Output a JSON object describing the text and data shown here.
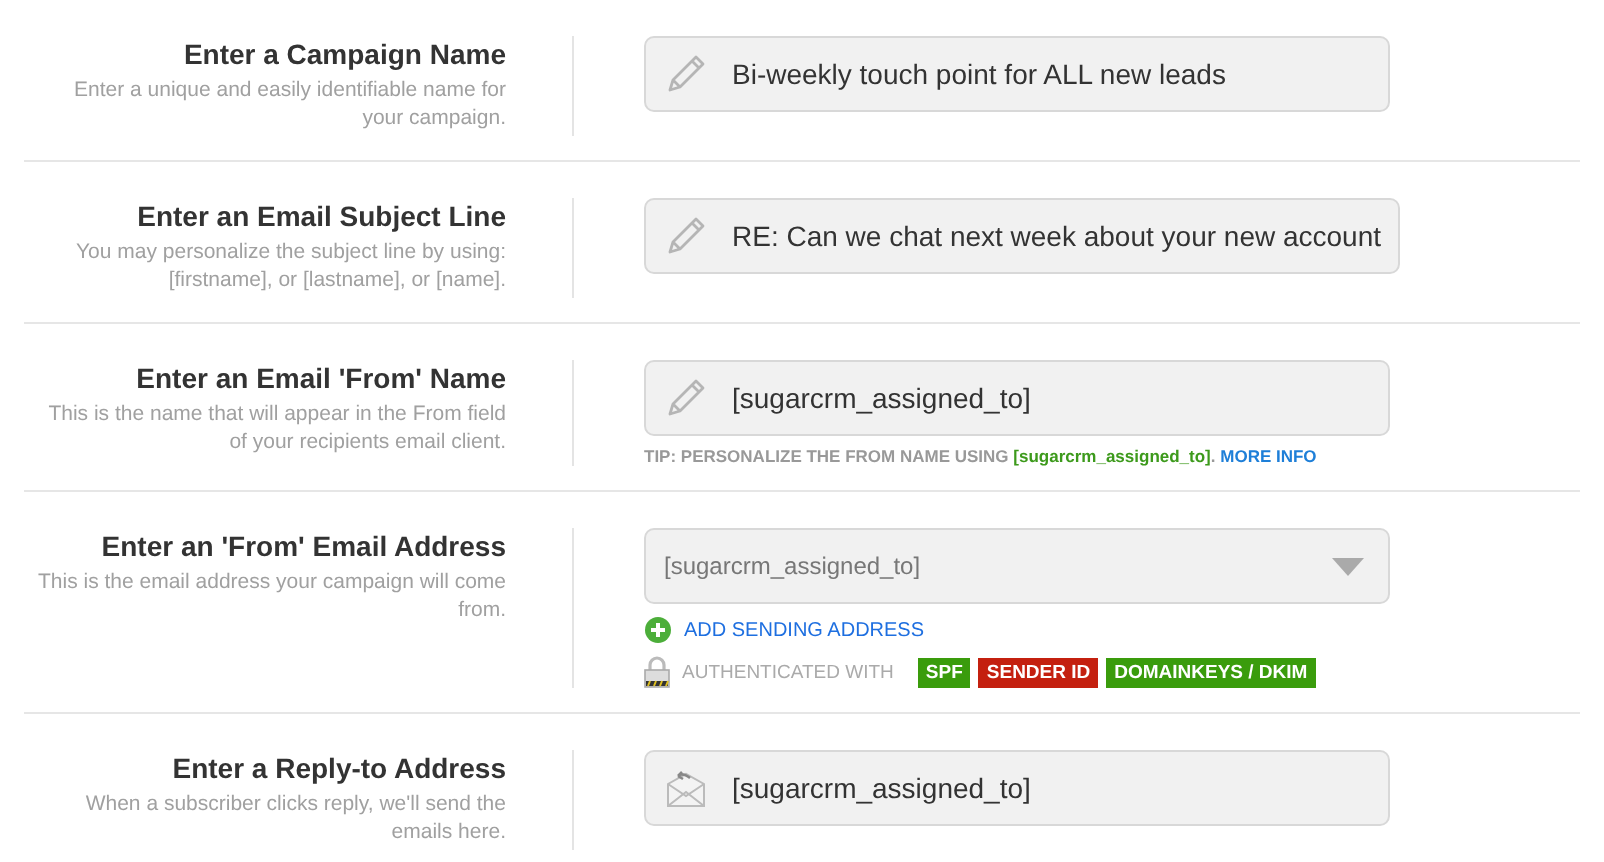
{
  "rows": [
    {
      "title": "Enter a Campaign Name",
      "description": "Enter a unique and easily identifiable name for your campaign.",
      "field": {
        "kind": "text",
        "value": "Bi-weekly touch point for ALL new leads"
      }
    },
    {
      "title": "Enter an Email Subject Line",
      "description": "You may personalize the subject line by using: [firstname], or [lastname], or [name].",
      "field": {
        "kind": "text",
        "value": "RE: Can we chat next week about your new account"
      }
    },
    {
      "title": "Enter an Email 'From' Name",
      "description": "This is the name that will appear in the From field of your recipients email client.",
      "field": {
        "kind": "text",
        "value": "[sugarcrm_assigned_to]"
      },
      "tip": {
        "prefix": "TIP: PERSONALIZE THE FROM NAME USING ",
        "code": "[sugarcrm_assigned_to]",
        "suffix": ".",
        "link": "MORE INFO"
      }
    },
    {
      "title": "Enter an 'From' Email Address",
      "description": "This is the email address your campaign will come from.",
      "field": {
        "kind": "select",
        "value": "[sugarcrm_assigned_to]"
      },
      "add_link": "ADD SENDING ADDRESS",
      "auth": {
        "label": "AUTHENTICATED WITH",
        "badges": [
          {
            "label": "SPF",
            "color": "#3a9c0c"
          },
          {
            "label": "SENDER ID",
            "color": "#c4200f"
          },
          {
            "label": "DOMAINKEYS / DKIM",
            "color": "#3a9c0c"
          }
        ]
      }
    },
    {
      "title": "Enter a Reply-to Address",
      "description": "When a subscriber clicks reply, we'll send the emails here.",
      "field": {
        "kind": "reply",
        "value": "[sugarcrm_assigned_to]"
      }
    }
  ]
}
